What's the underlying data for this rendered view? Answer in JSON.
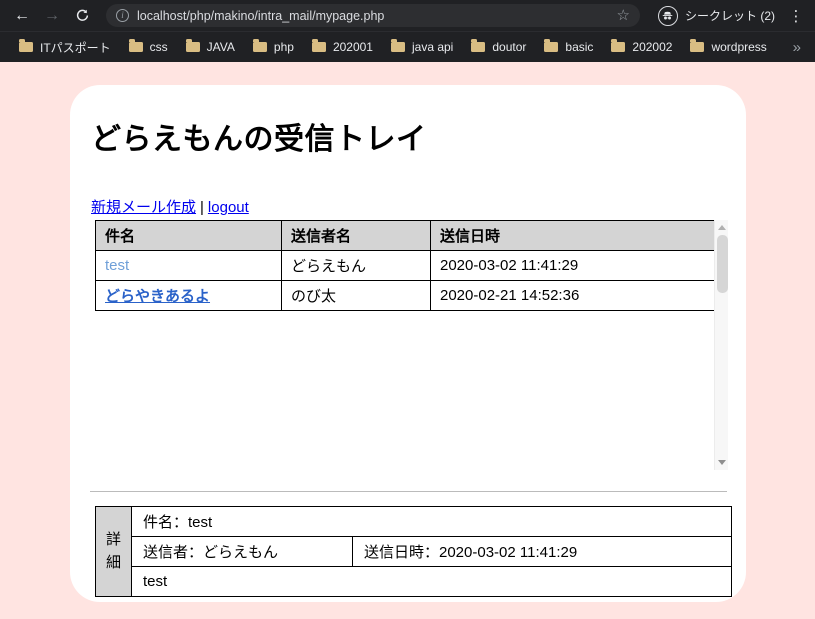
{
  "browser": {
    "url": "localhost/php/makino/intra_mail/mypage.php",
    "incognito_label": "シークレット  (2)",
    "bookmarks": [
      "ITパスポート",
      "css",
      "JAVA",
      "php",
      "202001",
      "java api",
      "doutor",
      "basic",
      "202002",
      "wordpress"
    ],
    "icons": {
      "back": "←",
      "forward": "→",
      "star": "☆",
      "menu": "⋮",
      "overflow": "»",
      "info": "i"
    }
  },
  "page": {
    "title": "どらえもんの受信トレイ",
    "nav": {
      "compose_label": "新規メール作成",
      "separator": "|",
      "logout_label": "logout"
    },
    "inbox": {
      "headers": {
        "subject": "件名",
        "sender": "送信者名",
        "datetime": "送信日時"
      },
      "rows": [
        {
          "subject": "test",
          "sender": "どらえもん",
          "datetime": "2020-03-02 11:41:29"
        },
        {
          "subject": "どらやきあるよ",
          "sender": "のび太",
          "datetime": "2020-02-21 14:52:36"
        }
      ]
    },
    "detail": {
      "label": "詳細",
      "subject": "件名：test",
      "sender": "送信者：どらえもん",
      "datetime": "送信日時：2020-03-02 11:41:29",
      "body": "test"
    }
  },
  "colors": {
    "page_background": "#ffe4e1",
    "card_background": "#ffffff",
    "table_header_bg": "#d4d4d4",
    "nav_link_blue": "#0000ee",
    "read_subject_link": "#6f9fd8",
    "unread_subject_link": "#2a62c9",
    "toolbar_bg": "#202124",
    "folder_icon": "#d9bd83"
  }
}
